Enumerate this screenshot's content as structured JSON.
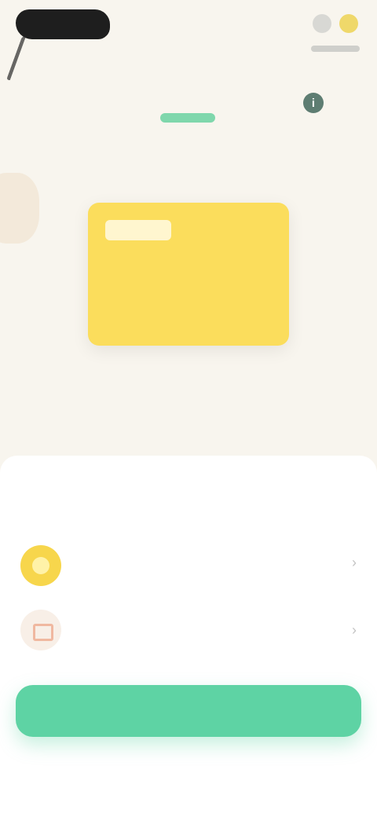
{
  "header": {
    "logo_icon": "brand-logo-icon",
    "actions": [
      "profile-icon",
      "gift-icon"
    ]
  },
  "promo": {
    "text": "",
    "link": "",
    "info_symbol": "i"
  },
  "gift_card": {
    "badge": "",
    "amount": "",
    "line1": "",
    "line2": "",
    "color": "#fbdd5c"
  },
  "sheet": {
    "title": "",
    "items": [
      {
        "icon": "coin-icon",
        "label": "",
        "value": ""
      },
      {
        "icon": "tag-icon",
        "label": "",
        "value": ""
      }
    ]
  },
  "cta": {
    "label": "",
    "color": "#5ed3a4"
  },
  "footer": {
    "link": ""
  }
}
